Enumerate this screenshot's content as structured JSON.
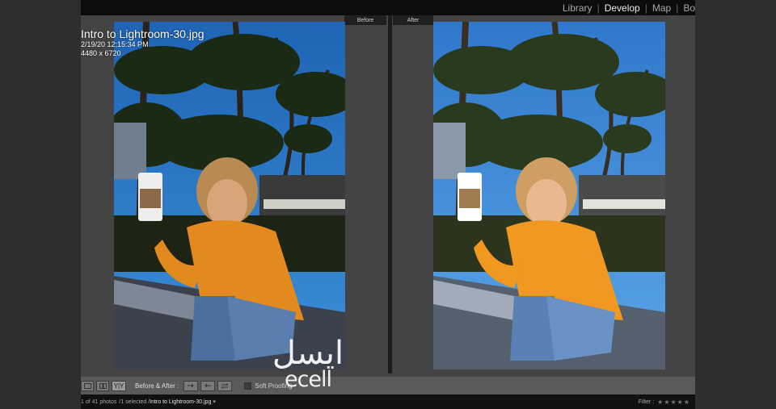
{
  "window": {
    "photo_info": {
      "filename": "Intro to Lightroom-30.jpg",
      "datetime": "2/19/20 12:15:34 PM",
      "dimensions": "4480 x 6720"
    }
  },
  "module_picker": {
    "items": [
      "Library",
      "Develop",
      "Map",
      "Bo"
    ],
    "active": "Develop"
  },
  "panes": {
    "before_label": "Before",
    "after_label": "After"
  },
  "toolbar": {
    "yy_label": "Y|Y",
    "before_after_label": "Before & After :",
    "soft_proofing_label": "Soft Proofing"
  },
  "filmstrip": {
    "photo_count": "1 of 41 photos",
    "selected": "/1 selected /",
    "filename": "Intro to Lightroom-30.jpg",
    "filter_label": "Filter :",
    "stars": "★★★★★"
  },
  "watermark": {
    "arabic": "ایسل",
    "latin": "ecell"
  },
  "colors": {
    "app_bg": "#444444",
    "nav_bg": "#0c0c0c",
    "sweater": "#e38a1f",
    "sky": "#2f86d6"
  }
}
